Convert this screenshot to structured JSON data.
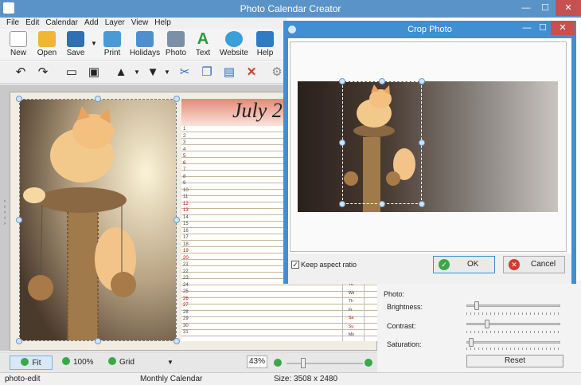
{
  "app": {
    "title": "Photo Calendar Creator",
    "minimize": "—",
    "maximize": "☐",
    "close": "✕"
  },
  "menu": [
    "File",
    "Edit",
    "Calendar",
    "Add",
    "Layer",
    "View",
    "Help"
  ],
  "toolbar": {
    "new": "New",
    "open": "Open",
    "save": "Save",
    "print": "Print",
    "holidays": "Holidays",
    "photo": "Photo",
    "text": "Text",
    "website": "Website",
    "help": "Help"
  },
  "calendar": {
    "month": "July 2",
    "day_numbers": [
      "1",
      "2",
      "3",
      "4",
      "5",
      "6",
      "7",
      "8",
      "9",
      "10",
      "11",
      "12",
      "13",
      "14",
      "15",
      "16",
      "17",
      "18",
      "19",
      "20",
      "21",
      "22",
      "23",
      "24",
      "25",
      "26",
      "27",
      "28",
      "29",
      "30",
      "31"
    ],
    "weekday_labels": [
      "Tu",
      "We",
      "Th",
      "Fr",
      "Sa",
      "Su",
      "Mo"
    ]
  },
  "bottombar": {
    "fit": "Fit",
    "zoom100": "100%",
    "grid": "Grid",
    "zoom_value": "43%"
  },
  "status": {
    "layer": "photo-edit",
    "type": "Monthly Calendar",
    "size": "Size: 3508 x 2480"
  },
  "photo_panel": {
    "title": "Photo:",
    "brightness": "Brightness:",
    "contrast": "Contrast:",
    "saturation": "Saturation:",
    "reset": "Reset",
    "brightness_level": 0.08,
    "contrast_level": 0.2,
    "saturation_level": 0.02
  },
  "dialog": {
    "title": "Crop Photo",
    "keep_aspect": "Keep aspect ratio",
    "ok": "OK",
    "cancel": "Cancel"
  }
}
